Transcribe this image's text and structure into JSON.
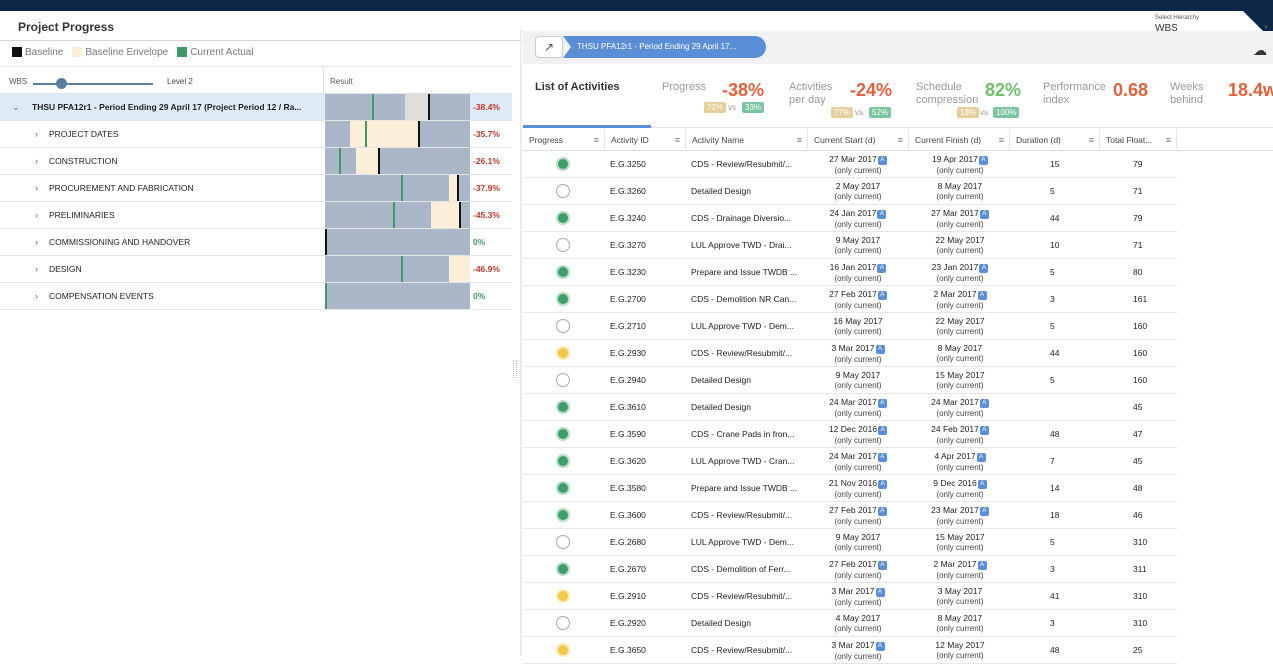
{
  "header": {
    "title": "Project Progress",
    "hierarchy_label": "Select Hierarchy",
    "hierarchy_value": "WBS"
  },
  "legend": {
    "baseline": "Baseline",
    "envelope": "Baseline Envelope",
    "actual": "Current Actual",
    "colors": {
      "baseline": "#111111",
      "envelope": "#fcefd9",
      "actual": "#3d9a64"
    }
  },
  "wbs_controls": {
    "wbs_label": "WBS",
    "level_label": "Level 2",
    "result_label": "Result"
  },
  "tree": [
    {
      "label": "THSU PFA12r1 - Period Ending 29 April 17 (Project Period 12 / Ra...",
      "result": "-38.4%",
      "root": true
    },
    {
      "label": "PROJECT DATES",
      "result": "-35.7%"
    },
    {
      "label": "CONSTRUCTION",
      "result": "-26.1%"
    },
    {
      "label": "PROCUREMENT AND FABRICATION",
      "result": "-37.9%"
    },
    {
      "label": "PRELIMINARIES",
      "result": "-45.3%"
    },
    {
      "label": "COMMISSIONING AND HANDOVER",
      "result": "0%"
    },
    {
      "label": "DESIGN",
      "result": "-46.9%"
    },
    {
      "label": "COMPENSATION EVENTS",
      "result": "0%"
    }
  ],
  "breadcrumb": "THSU PFA12r1 - Period Ending 29 April 17...",
  "kpis": {
    "list_title": "List of Activities",
    "progress": {
      "label": "Progress",
      "value": "-38%",
      "a": "72%",
      "vs": "vs",
      "b": "33%"
    },
    "activities": {
      "label1": "Activities",
      "label2": "per day",
      "value": "-24%",
      "a": "77%",
      "vs": "vs",
      "b": "52%"
    },
    "schedule": {
      "label1": "Schedule",
      "label2": "compression",
      "value": "82%",
      "a": "18%",
      "vs": "vs",
      "b": "100%"
    },
    "performance": {
      "label1": "Performance",
      "label2": "index",
      "value": "0.68"
    },
    "weeks": {
      "label1": "Weeks",
      "label2": "behind",
      "value": "18.4w"
    }
  },
  "columns": [
    "Progress",
    "Activity ID",
    "Activity Name",
    "Current Start (d)",
    "Current Finish (d)",
    "Duration (d)",
    "Total Float..."
  ],
  "column_menu_icon": "menu-icon",
  "only_current": "(only current)",
  "badge": "A",
  "activities": [
    {
      "status": "green",
      "id": "E.G.3250",
      "name": "CDS - Review/Resubmit/...",
      "start": "27 Mar 2017",
      "start_a": true,
      "finish": "19 Apr 2017",
      "finish_a": true,
      "duration": "15",
      "float": "79"
    },
    {
      "status": "empty",
      "id": "E.G.3260",
      "name": "Detailed Design",
      "start": "2 May 2017",
      "start_a": false,
      "finish": "8 May 2017",
      "finish_a": false,
      "duration": "5",
      "float": "71"
    },
    {
      "status": "green",
      "id": "E.G.3240",
      "name": "CDS - Drainage Diversio...",
      "start": "24 Jan 2017",
      "start_a": true,
      "finish": "27 Mar 2017",
      "finish_a": true,
      "duration": "44",
      "float": "79"
    },
    {
      "status": "empty",
      "id": "E.G.3270",
      "name": "LUL Approve TWD - Drai...",
      "start": "9 May 2017",
      "start_a": false,
      "finish": "22 May 2017",
      "finish_a": false,
      "duration": "10",
      "float": "71"
    },
    {
      "status": "green",
      "id": "E.G.3230",
      "name": "Prepare and Issue TWDB ...",
      "start": "16 Jan 2017",
      "start_a": true,
      "finish": "23 Jan 2017",
      "finish_a": true,
      "duration": "5",
      "float": "80"
    },
    {
      "status": "green",
      "id": "E.G.2700",
      "name": "CDS - Demolition NR Can...",
      "start": "27 Feb 2017",
      "start_a": true,
      "finish": "2 Mar 2017",
      "finish_a": true,
      "duration": "3",
      "float": "161"
    },
    {
      "status": "empty",
      "id": "E.G.2710",
      "name": "LUL Approve TWD - Dem...",
      "start": "16 May 2017",
      "start_a": false,
      "finish": "22 May 2017",
      "finish_a": false,
      "duration": "5",
      "float": "160"
    },
    {
      "status": "yellow",
      "id": "E.G.2930",
      "name": "CDS - Review/Resubmit/...",
      "start": "3 Mar 2017",
      "start_a": true,
      "finish": "8 May 2017",
      "finish_a": false,
      "duration": "44",
      "float": "160"
    },
    {
      "status": "empty",
      "id": "E.G.2940",
      "name": "Detailed Design",
      "start": "9 May 2017",
      "start_a": false,
      "finish": "15 May 2017",
      "finish_a": false,
      "duration": "5",
      "float": "160"
    },
    {
      "status": "green",
      "id": "E.G.3610",
      "name": "Detailed Design",
      "start": "24 Mar 2017",
      "start_a": true,
      "finish": "24 Mar 2017",
      "finish_a": true,
      "duration": "",
      "float": "45"
    },
    {
      "status": "green",
      "id": "E.G.3590",
      "name": "CDS - Crane Pads in fron...",
      "start": "12 Dec 2016",
      "start_a": true,
      "finish": "24 Feb 2017",
      "finish_a": true,
      "duration": "48",
      "float": "47"
    },
    {
      "status": "green",
      "id": "E.G.3620",
      "name": "LUL Approve TWD - Cran...",
      "start": "24 Mar 2017",
      "start_a": true,
      "finish": "4 Apr 2017",
      "finish_a": true,
      "duration": "7",
      "float": "45"
    },
    {
      "status": "green",
      "id": "E.G.3580",
      "name": "Prepare and Issue TWDB ...",
      "start": "21 Nov 2016",
      "start_a": true,
      "finish": "9 Dec 2016",
      "finish_a": true,
      "duration": "14",
      "float": "48"
    },
    {
      "status": "green",
      "id": "E.G.3600",
      "name": "CDS - Review/Resubmit/...",
      "start": "27 Feb 2017",
      "start_a": true,
      "finish": "23 Mar 2017",
      "finish_a": true,
      "duration": "18",
      "float": "46"
    },
    {
      "status": "empty",
      "id": "E.G.2680",
      "name": "LUL Approve TWD - Dem...",
      "start": "9 May 2017",
      "start_a": false,
      "finish": "15 May 2017",
      "finish_a": false,
      "duration": "5",
      "float": "310"
    },
    {
      "status": "green",
      "id": "E.G.2670",
      "name": "CDS - Demolition of Ferr...",
      "start": "27 Feb 2017",
      "start_a": true,
      "finish": "2 Mar 2017",
      "finish_a": true,
      "duration": "3",
      "float": "311"
    },
    {
      "status": "yellow",
      "id": "E.G.2910",
      "name": "CDS - Review/Resubmit/...",
      "start": "3 Mar 2017",
      "start_a": true,
      "finish": "3 May 2017",
      "finish_a": false,
      "duration": "41",
      "float": "310"
    },
    {
      "status": "empty",
      "id": "E.G.2920",
      "name": "Detailed Design",
      "start": "4 May 2017",
      "start_a": false,
      "finish": "8 May 2017",
      "finish_a": false,
      "duration": "3",
      "float": "310"
    },
    {
      "status": "yellow",
      "id": "E.G.3650",
      "name": "CDS - Review/Resubmit/...",
      "start": "3 Mar 2017",
      "start_a": true,
      "finish": "12 May 2017",
      "finish_a": false,
      "duration": "48",
      "float": "25"
    }
  ]
}
